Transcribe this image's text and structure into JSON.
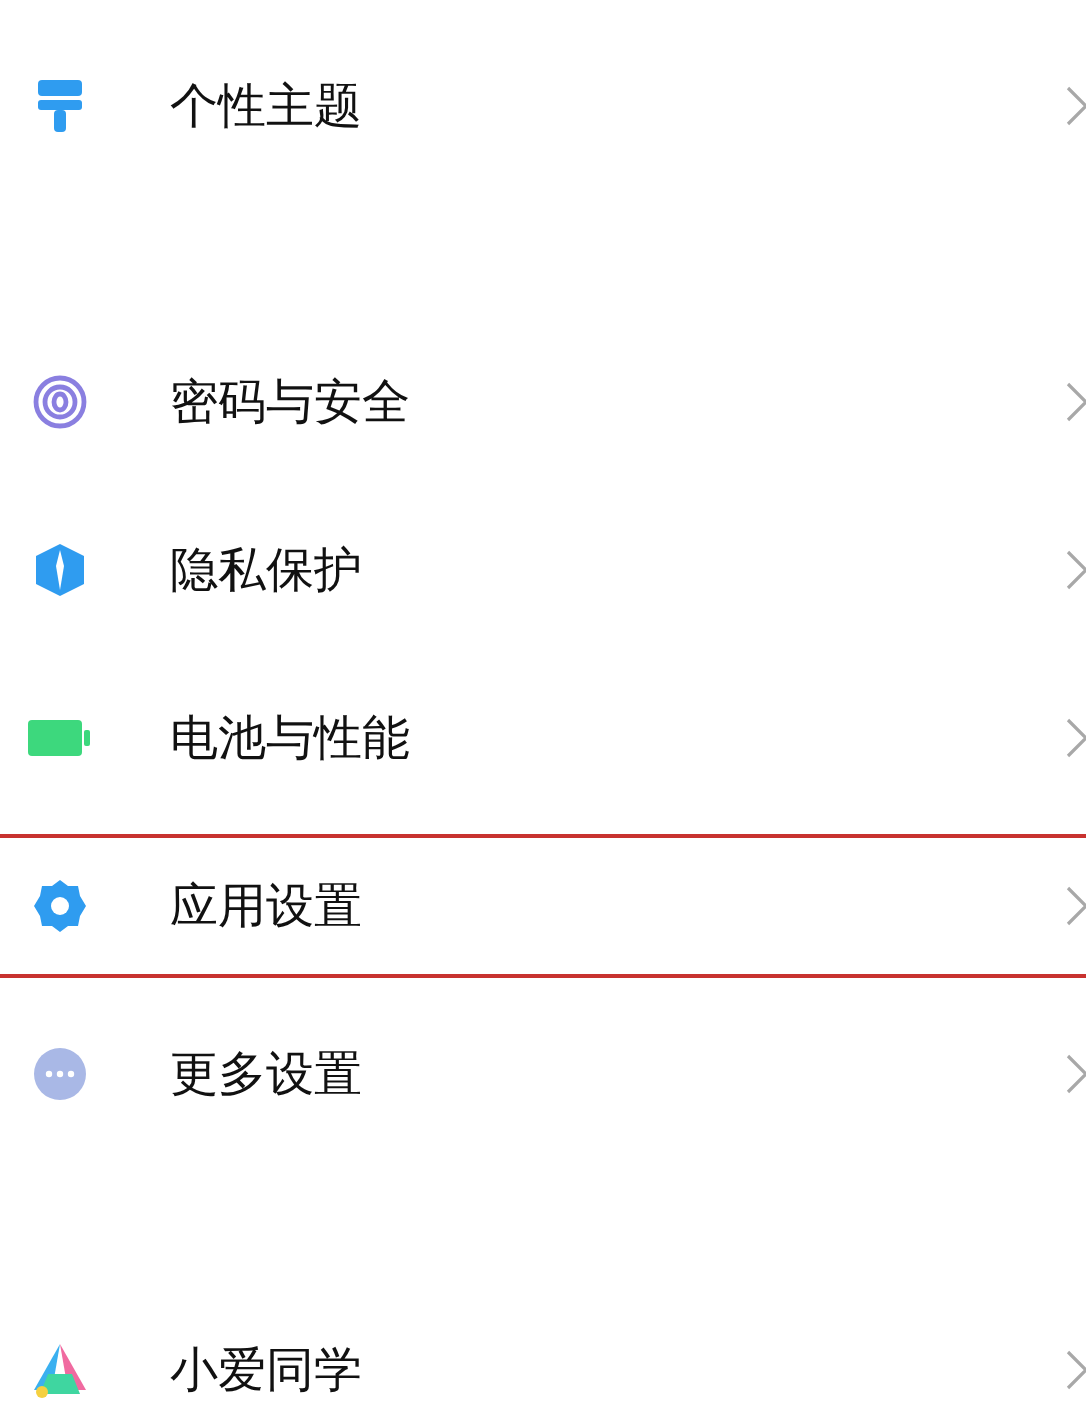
{
  "groups": [
    {
      "items": [
        {
          "kind": "theme",
          "label": "个性主题",
          "selected": false
        }
      ]
    },
    {
      "items": [
        {
          "kind": "fingerprint",
          "label": "密码与安全",
          "selected": false
        },
        {
          "kind": "shield",
          "label": "隐私保护",
          "selected": false
        },
        {
          "kind": "battery",
          "label": "电池与性能",
          "selected": false
        },
        {
          "kind": "gear",
          "label": "应用设置",
          "selected": true
        },
        {
          "kind": "more",
          "label": "更多设置",
          "selected": false
        }
      ]
    },
    {
      "items": [
        {
          "kind": "assistant",
          "label": "小爱同学",
          "selected": false
        }
      ]
    }
  ]
}
